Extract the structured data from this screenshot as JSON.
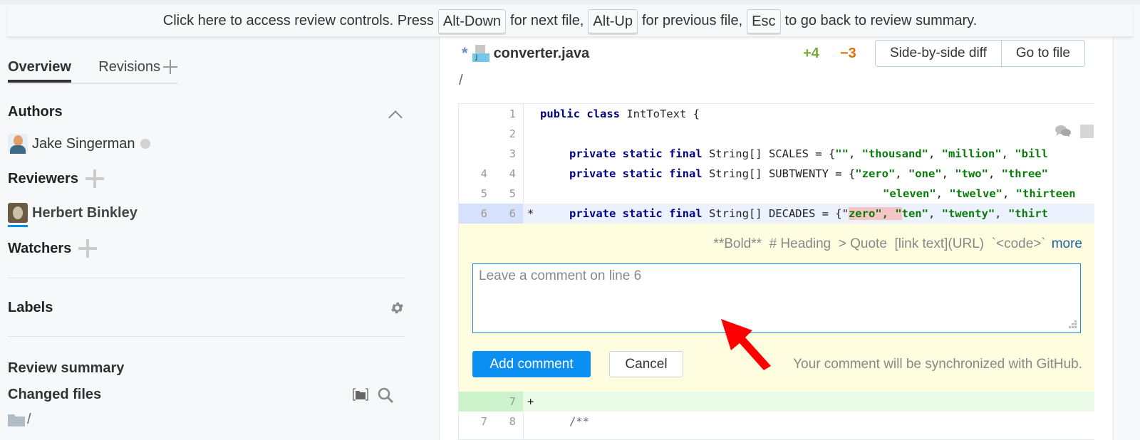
{
  "banner": {
    "text_1": "Click here to access review controls. Press",
    "key_next": "Alt-Down",
    "text_2": "for next file,",
    "key_prev": "Alt-Up",
    "text_3": "for previous file,",
    "key_esc": "Esc",
    "text_4": "to go back to review summary."
  },
  "sidebar": {
    "tabs": [
      {
        "label": "Overview",
        "active": true
      },
      {
        "label": "Revisions",
        "active": false
      }
    ],
    "authors_title": "Authors",
    "authors": [
      {
        "name": "Jake Singerman",
        "status": "offline"
      }
    ],
    "reviewers_title": "Reviewers",
    "reviewers": [
      {
        "name": "Herbert Binkley"
      }
    ],
    "watchers_title": "Watchers",
    "labels_title": "Labels",
    "review_summary": "Review summary",
    "changed_files": "Changed files",
    "root_path": "/"
  },
  "file": {
    "modified_marker": "*",
    "icon_letter": "J",
    "name": "converter.java",
    "path": "/",
    "additions": "+4",
    "deletions": "−3",
    "side_by_side_label": "Side-by-side diff",
    "go_to_file_label": "Go to file"
  },
  "diff": {
    "rows": [
      {
        "old": "",
        "new": "1",
        "marker": "",
        "type": "context"
      },
      {
        "old": "",
        "new": "2",
        "marker": "",
        "type": "context"
      },
      {
        "old": "",
        "new": "3",
        "marker": "",
        "type": "context"
      },
      {
        "old": "4",
        "new": "4",
        "marker": "",
        "type": "context"
      },
      {
        "old": "5",
        "new": "5",
        "marker": "",
        "type": "context"
      },
      {
        "old": "6",
        "new": "6",
        "marker": "*",
        "type": "selected"
      },
      {
        "old": "",
        "new": "7",
        "marker": "+",
        "type": "added"
      },
      {
        "old": "7",
        "new": "8",
        "marker": "",
        "type": "context"
      }
    ],
    "code": {
      "l1_kw": "public class",
      "l1_rest": " IntToText {",
      "l3_kw": "private static final",
      "l3_mid": " String[] SCALES = {",
      "l3_s1": "\"\"",
      "l3_s2": "\"thousand\"",
      "l3_s3": "\"million\"",
      "l3_s4": "\"bill",
      "l4_kw": "private static final",
      "l4_mid": " String[] SUBTWENTY = {",
      "l4_s1": "\"zero\"",
      "l4_s2": "\"one\"",
      "l4_s3": "\"two\"",
      "l4_s4": "\"three\"",
      "l5_s1": "\"eleven\"",
      "l5_s2": "\"twelve\"",
      "l5_s3": "\"thirteen",
      "l6_kw": "private static final",
      "l6_mid": " String[] DECADES = {\"",
      "l6_del": "zero\", \"",
      "l6_s1": "ten\"",
      "l6_s2": "\"twenty\"",
      "l6_s3": "\"thirt",
      "l8": "/**"
    }
  },
  "comment": {
    "md_hints": "**Bold**  # Heading  > Quote  [link text](URL)  `<code>`",
    "more_label": "more",
    "placeholder": "Leave a comment on line 6",
    "value": "",
    "add_label": "Add comment",
    "cancel_label": "Cancel",
    "sync_note": "Your comment will be synchronized with GitHub."
  },
  "colors": {
    "accent": "#0b8ff2",
    "additions": "#7aa83c",
    "deletions": "#e0700c",
    "annotation_arrow": "#ff0000"
  }
}
